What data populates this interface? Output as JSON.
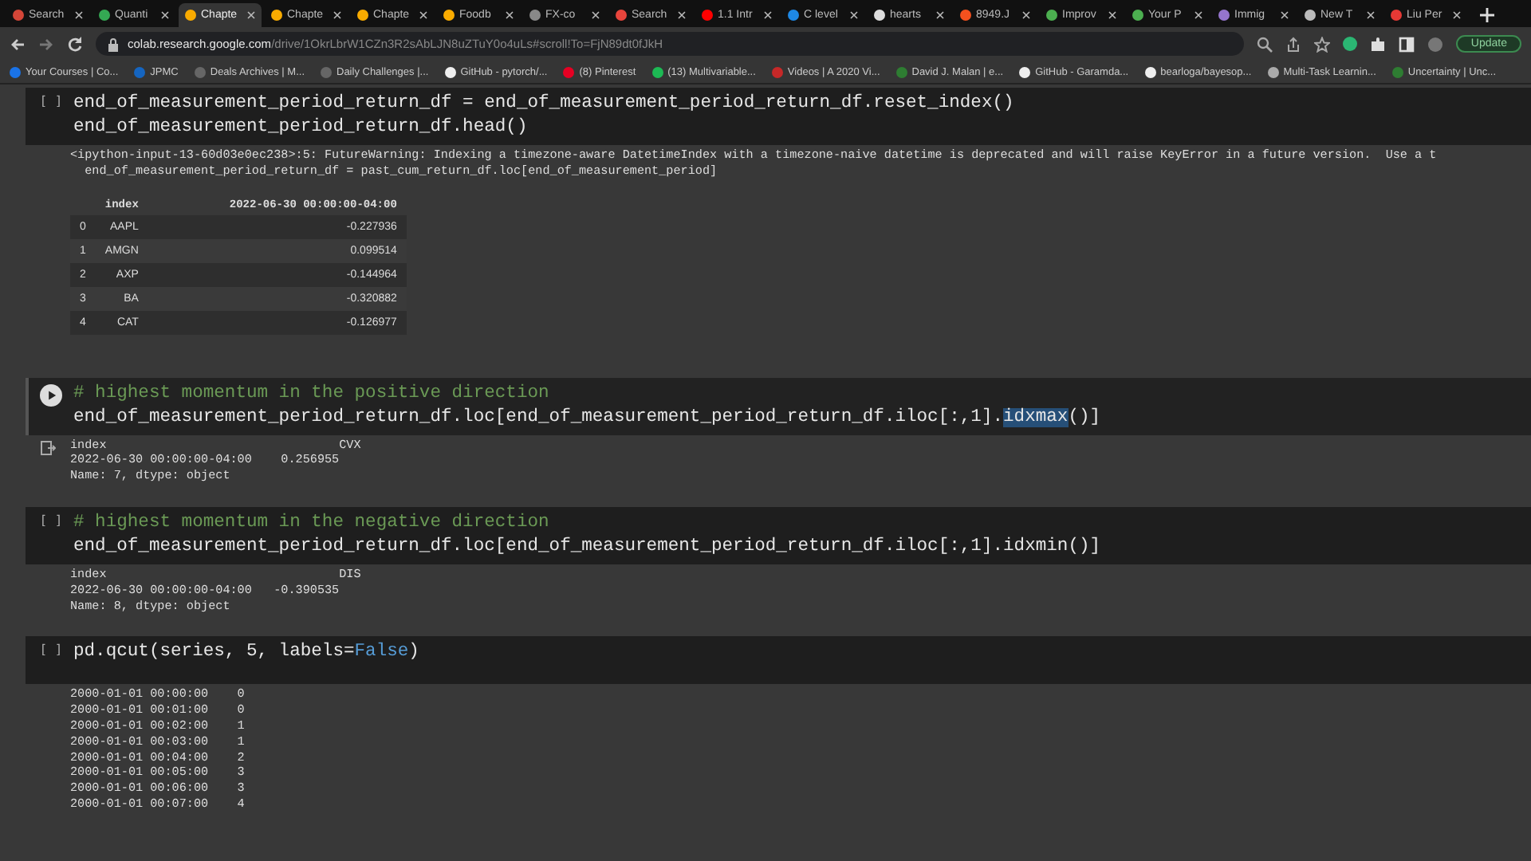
{
  "tabs": [
    {
      "label": "Search",
      "color": "#d44638",
      "selected": false
    },
    {
      "label": "Quanti",
      "color": "#34a853",
      "selected": false
    },
    {
      "label": "Chapte",
      "color": "#f9ab00",
      "selected": true
    },
    {
      "label": "Chapte",
      "color": "#f9ab00",
      "selected": false
    },
    {
      "label": "Chapte",
      "color": "#f9ab00",
      "selected": false
    },
    {
      "label": "Foodb",
      "color": "#f9ab00",
      "selected": false
    },
    {
      "label": "FX-co",
      "color": "#888888",
      "selected": false
    },
    {
      "label": "Search",
      "color": "#e8453c",
      "selected": false
    },
    {
      "label": "1.1 Intr",
      "color": "#ff0000",
      "selected": false
    },
    {
      "label": "C level",
      "color": "#1e88e5",
      "selected": false
    },
    {
      "label": "hearts",
      "color": "#dddddd",
      "selected": false
    },
    {
      "label": "8949.J",
      "color": "#f4511e",
      "selected": false
    },
    {
      "label": "Improv",
      "color": "#4caf50",
      "selected": false
    },
    {
      "label": "Your P",
      "color": "#4caf50",
      "selected": false
    },
    {
      "label": "Immig",
      "color": "#9575cd",
      "selected": false
    },
    {
      "label": "New T",
      "color": "#bbbbbb",
      "selected": false
    },
    {
      "label": "Liu Per",
      "color": "#e53935",
      "selected": false
    }
  ],
  "toolbar": {
    "host": "colab.research.google.com",
    "path": "/drive/1OkrLbrW1CZn3R2sAbLJN8uZTuY0o4uLs#scroll!To=FjN89dt0fJkH",
    "update_button": "Update"
  },
  "bookmarks": [
    {
      "label": "Your Courses | Co...",
      "color": "#1a73e8"
    },
    {
      "label": "JPMC",
      "color": "#1565c0"
    },
    {
      "label": "Deals Archives | M...",
      "color": "#666666"
    },
    {
      "label": "Daily Challenges |...",
      "color": "#666666"
    },
    {
      "label": "GitHub - pytorch/...",
      "color": "#eeeeee"
    },
    {
      "label": "(8) Pinterest",
      "color": "#e60023"
    },
    {
      "label": "(13) Multivariable...",
      "color": "#1db954"
    },
    {
      "label": "Videos | A 2020 Vi...",
      "color": "#c62828"
    },
    {
      "label": "David J. Malan | e...",
      "color": "#2e7d32"
    },
    {
      "label": "GitHub - Garamda...",
      "color": "#eeeeee"
    },
    {
      "label": "bearloga/bayesop...",
      "color": "#eeeeee"
    },
    {
      "label": "Multi-Task Learnin...",
      "color": "#aaaaaa"
    },
    {
      "label": "Uncertainty | Unc...",
      "color": "#2e7d32"
    }
  ],
  "cells": [
    {
      "prompt": "[ ]",
      "focused": false,
      "code": [
        [
          {
            "kind": "plain",
            "text": "end_of_measurement_period_return_df = end_of_measurement_period_return_df.reset_index()"
          }
        ],
        [
          {
            "kind": "plain",
            "text": "end_of_measurement_period_return_df.head()"
          }
        ]
      ],
      "outputs": [
        {
          "kind": "text",
          "lines": [
            "<ipython-input-13-60d03e0ec238>:5: FutureWarning: Indexing a timezone-aware DatetimeIndex with a timezone-naive datetime is deprecated and will raise KeyError in a future version.  Use a t",
            "  end_of_measurement_period_return_df = past_cum_return_df.loc[end_of_measurement_period]"
          ]
        },
        {
          "kind": "table",
          "columns": [
            "",
            "index",
            "2022-06-30 00:00:00-04:00"
          ],
          "rows": [
            [
              "0",
              "AAPL",
              "-0.227936"
            ],
            [
              "1",
              "AMGN",
              "0.099514"
            ],
            [
              "2",
              "AXP",
              "-0.144964"
            ],
            [
              "3",
              "BA",
              "-0.320882"
            ],
            [
              "4",
              "CAT",
              "-0.126977"
            ]
          ]
        }
      ]
    },
    {
      "focused": true,
      "code": [
        [
          {
            "kind": "comment",
            "text": "# highest momentum in the positive direction"
          }
        ],
        [
          {
            "kind": "plain",
            "text": "end_of_measurement_period_return_df.loc[end_of_measurement_period_return_df.iloc[:,1]."
          },
          {
            "kind": "selected",
            "text": "idxmax"
          },
          {
            "kind": "plain",
            "text": "()]"
          }
        ]
      ],
      "outputs": [
        {
          "kind": "text",
          "lines": [
            "index                                CVX",
            "2022-06-30 00:00:00-04:00    0.256955",
            "Name: 7, dtype: object"
          ]
        }
      ]
    },
    {
      "prompt": "[ ]",
      "focused": false,
      "code": [
        [
          {
            "kind": "comment",
            "text": "# highest momentum in the negative direction"
          }
        ],
        [
          {
            "kind": "plain",
            "text": "end_of_measurement_period_return_df.loc[end_of_measurement_period_return_df.iloc[:,1].idxmin()]"
          }
        ]
      ],
      "outputs": [
        {
          "kind": "text",
          "lines": [
            "index                                DIS",
            "2022-06-30 00:00:00-04:00   -0.390535",
            "Name: 8, dtype: object"
          ]
        }
      ]
    },
    {
      "prompt": "[ ]",
      "focused": false,
      "code": [
        [
          {
            "kind": "plain",
            "text": "pd.qcut(series, 5, labels="
          },
          {
            "kind": "keyword",
            "text": "False"
          },
          {
            "kind": "plain",
            "text": ")"
          }
        ]
      ],
      "outputs": [
        {
          "kind": "text",
          "lines": [
            "2000-01-01 00:00:00    0",
            "2000-01-01 00:01:00    0",
            "2000-01-01 00:02:00    1",
            "2000-01-01 00:03:00    1",
            "2000-01-01 00:04:00    2",
            "2000-01-01 00:05:00    3",
            "2000-01-01 00:06:00    3",
            "2000-01-01 00:07:00    4"
          ]
        }
      ]
    }
  ]
}
